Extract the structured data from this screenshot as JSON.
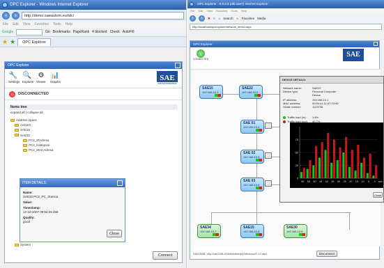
{
  "left_browser": {
    "title": "OPC Explorer - Windows Internet Explorer",
    "address": "http://demo.saeautom.eu/tdc/",
    "menu": [
      "File",
      "Edit",
      "View",
      "Favorites",
      "Tools",
      "Help"
    ],
    "google_label": "Google",
    "go_label": "Go",
    "bookmarks_label": "Bookmarks",
    "pagerank_label": "PageRank",
    "blocked_label": "4 blocked",
    "check_label": "Check",
    "autofill_label": "AutoFill",
    "tab_label": "OPC Explorer"
  },
  "left_app": {
    "header": "OPC Explorer",
    "tools": [
      {
        "label": "Settings",
        "icon": "wrench-icon",
        "glyph": "🔧"
      },
      {
        "label": "Explorer",
        "icon": "magnifier-icon",
        "glyph": "🔍"
      },
      {
        "label": "Viewer",
        "icon": "tree-icon",
        "glyph": "⚙"
      },
      {
        "label": "Graphs",
        "icon": "bar-graph-icon",
        "glyph": "📊"
      }
    ],
    "logo_text": "SAE",
    "logo_sub": "SAE AUTOMATION",
    "status": "DISCONNECTED",
    "tree_header": "Items tree",
    "expand_all": "expand all",
    "collapse_all": "collapse all",
    "tree": [
      {
        "label": "Address space",
        "level": 0
      },
      {
        "label": "ActiveX",
        "level": 1
      },
      {
        "label": "SAE15",
        "level": 1
      },
      {
        "label": "SAE22",
        "level": 1
      },
      {
        "label": "PC2_IPAdresa",
        "level": 2
      },
      {
        "label": "PC2_Kategorie",
        "level": 2
      },
      {
        "label": "PC2_MACAdresa",
        "level": 2
      },
      {
        "label": "System",
        "level": 1
      }
    ],
    "item_details": {
      "header": "ITEM DETAILS:",
      "name_label": "Name:",
      "name_value": "SAE22.PC2_PC_Stanica",
      "value_label": "Value:",
      "value_value": "",
      "timestamp_label": "Timestamp:",
      "timestamp_value": "12-10-2007 09:54:29.468",
      "quality_label": "Quality:",
      "quality_value": "good",
      "close_label": "Close"
    },
    "connect_label": "Connect"
  },
  "right_browser": {
    "title": "OPC Explorer - 8.8.8.8 (dtb.saeT) Internet Explorer",
    "menu": [
      "File",
      "Edit",
      "View",
      "Favorites",
      "Tools",
      "Help"
    ],
    "search_label": "Search",
    "favorites_label": "Favorites",
    "media_label": "Media",
    "address": "http://localhost/opcexplorer/network_demo.aspx"
  },
  "right_app": {
    "header": "OPC Explorer",
    "connected_label": "CONNECTED",
    "logo_text": "SAE",
    "nodes": [
      {
        "name": "SAE15",
        "ip": "192.168.10.1"
      },
      {
        "name": "SAE22",
        "ip": "192.168.10.2"
      },
      {
        "name": "SAE 01",
        "ip": "192.168.10.4"
      },
      {
        "name": "SAE 02",
        "ip": "192.168.10.5"
      },
      {
        "name": "SAE 03",
        "ip": "192.168.10.6"
      },
      {
        "name": "SAE34",
        "ip": "192.168.10.7"
      },
      {
        "name": "SAE15",
        "ip": "192.168.10.8"
      },
      {
        "name": "SAE30",
        "ip": "192.168.10.9"
      }
    ],
    "device_details": {
      "header": "DEVICE DETAILS:",
      "rows": [
        {
          "k": "Network name:",
          "v": "SAE22"
        },
        {
          "k": "Device type:",
          "v": "Personal Computer"
        },
        {
          "k": "",
          "v": "Device"
        },
        {
          "k": "IP address:",
          "v": "192.168.10.1"
        },
        {
          "k": "MAC address:",
          "v": "00:50:a1:11:67:23:00"
        },
        {
          "k": "Serial number:",
          "v": "1123738"
        }
      ],
      "traffic_in_label": "Traffic load (in):",
      "traffic_in_value": "1.8%",
      "traffic_out_label": "Traffic load (out):",
      "traffic_out_value": "40.7%",
      "close_label": "Close"
    },
    "footer": "SAE22MIB - http://sae22/MLXX/Adrenaline/ip0/Windows/IP-4.0.aspx",
    "disconnect_label": "Disconnect",
    "colors": {
      "in": "#1fbf1f",
      "out": "#c91818"
    }
  },
  "chart_data": {
    "type": "bar",
    "categories": [
      "60",
      "55",
      "50",
      "45",
      "40",
      "35",
      "30",
      "25",
      "20",
      "15",
      "10",
      "5",
      "0"
    ],
    "ylim": [
      0,
      100
    ],
    "yticks": [
      0,
      25,
      50,
      75
    ],
    "xlabel": "sec",
    "grid": true,
    "series": [
      {
        "values": [
          12,
          18,
          25,
          40,
          55,
          30,
          35,
          50,
          22,
          15,
          30,
          10,
          5
        ]
      },
      {
        "values": [
          20,
          35,
          62,
          70,
          88,
          75,
          60,
          80,
          55,
          65,
          40,
          48,
          25
        ]
      }
    ]
  }
}
